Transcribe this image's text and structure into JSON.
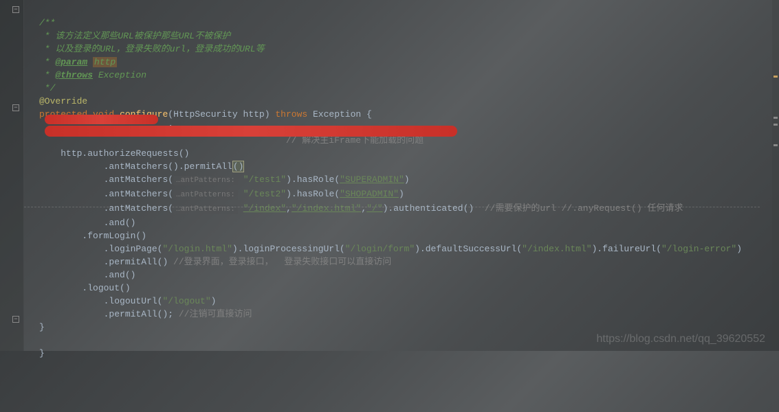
{
  "doc": {
    "open": "/**",
    "line1": " * 该方法定义那些URL被保护那些URL不被保护",
    "line2": " * 以及登录的URL，登录失败的url，登录成功的URL等",
    "line3_prefix": " * ",
    "param_tag": "@param",
    "param_name": "http",
    "line4_prefix": " * ",
    "throws_tag": "@throws",
    "throws_name": " Exception",
    "close": " */"
  },
  "code": {
    "annotation": "@Override",
    "kw_protected": "protected",
    "kw_void": "void",
    "method": "configure",
    "param_type": "HttpSecurity",
    "param_var": "http",
    "kw_throws": "throws",
    "exc": "Exception",
    "brace_open": "{",
    "redacted1_suffix": ";",
    "redacted2_comment": "// 解决主iFrame下能加载的问题",
    "http_auth": "http.authorizeRequests()",
    "ant1": ".antMatchers().permitAll",
    "ant2_pre": ".antMatchers(",
    "hint_ant": "…antPatterns:",
    "ant2_str": "\"/test1\"",
    "ant2_mid": ").hasRole(",
    "ant2_role": "\"SUPERADMIN\"",
    "ant2_end": ")",
    "ant3_pre": ".antMatchers(",
    "ant3_str": "\"/test2\"",
    "ant3_mid": ").hasRole(",
    "ant3_role": "\"SHOPADMIN\"",
    "ant3_end": ")",
    "ant4_pre": ".antMatchers(",
    "ant4_str1": "\"/index\"",
    "ant4_str2": "\"/index.html\"",
    "ant4_str3": "\"/\"",
    "ant4_mid": ").authenticated()  ",
    "ant4_comment": "//需要保护的url //.anyRequest() 任何请求",
    "and1": ".and()",
    "formLogin": ".formLogin()",
    "login_pre": ".loginPage(",
    "login_page": "\"/login.html\"",
    "login_proc_pre": ").loginProcessingUrl(",
    "login_proc": "\"/login/form\"",
    "login_succ_pre": ").defaultSuccessUrl(",
    "login_succ": "\"/index.html\"",
    "login_fail_pre": ").failureUrl(",
    "login_fail": "\"/login-error\"",
    "login_end": ")",
    "permit1": ".permitAll() ",
    "permit1_comment": "//登录界面，登录接口，  登录失败接口可以直接访问",
    "and2": ".and()",
    "logout": ".logout()",
    "logout_url_pre": ".logoutUrl(",
    "logout_url": "\"/logout\"",
    "logout_url_end": ")",
    "permit2": ".permitAll(); ",
    "permit2_comment": "//注销可直接访问",
    "brace_close1": "}",
    "brace_close2": "}"
  },
  "watermark": "https://blog.csdn.net/qq_39620552"
}
